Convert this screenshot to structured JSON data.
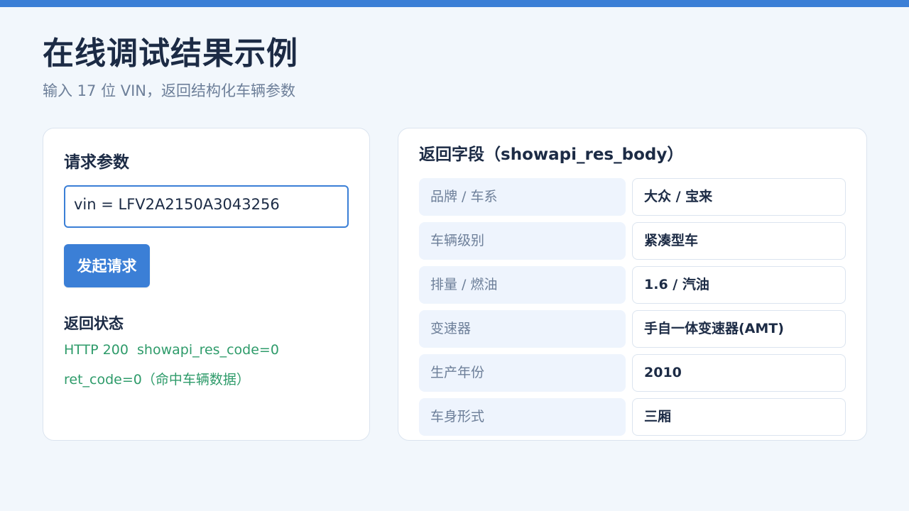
{
  "header": {
    "title": "在线调试结果示例",
    "subtitle": "输入 17 位 VIN，返回结构化车辆参数"
  },
  "request": {
    "title": "请求参数",
    "vin_value": "vin = LFV2A2150A3043256",
    "submit_label": "发起请求",
    "status_title": "返回状态",
    "status_lines": [
      "HTTP 200  showapi_res_code=0",
      "ret_code=0（命中车辆数据）"
    ]
  },
  "response": {
    "title": "返回字段（showapi_res_body）",
    "fields": [
      {
        "label": "品牌 / 车系",
        "value": "大众 / 宝来"
      },
      {
        "label": "车辆级别",
        "value": "紧凑型车"
      },
      {
        "label": "排量 / 燃油",
        "value": "1.6 / 汽油"
      },
      {
        "label": "变速器",
        "value": "手自一体变速器(AMT)"
      },
      {
        "label": "生产年份",
        "value": "2010"
      },
      {
        "label": "车身形式",
        "value": "三厢"
      }
    ]
  },
  "colors": {
    "accent": "#3b7fd6",
    "status_success": "#2e9b6a",
    "background": "#f2f7fc"
  }
}
